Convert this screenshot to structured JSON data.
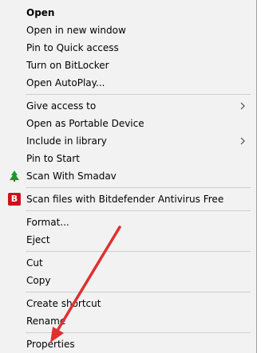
{
  "menu": {
    "items": [
      {
        "label": "Open"
      },
      {
        "label": "Open in new window"
      },
      {
        "label": "Pin to Quick access"
      },
      {
        "label": "Turn on BitLocker"
      },
      {
        "label": "Open AutoPlay..."
      },
      {
        "label": "Give access to"
      },
      {
        "label": "Open as Portable Device"
      },
      {
        "label": "Include in library"
      },
      {
        "label": "Pin to Start"
      },
      {
        "label": "Scan With Smadav"
      },
      {
        "label": "Scan files with Bitdefender Antivirus Free"
      },
      {
        "label": "Format..."
      },
      {
        "label": "Eject"
      },
      {
        "label": "Cut"
      },
      {
        "label": "Copy"
      },
      {
        "label": "Create shortcut"
      },
      {
        "label": "Rename"
      },
      {
        "label": "Properties"
      }
    ],
    "icons": {
      "smadav": "smadav-icon",
      "bitdefender": "bitdefender-icon",
      "bitdefender_letter": "B",
      "submenu": "chevron-right-icon"
    }
  },
  "colors": {
    "menu_background": "#f2f2f2",
    "separator": "#cfcfcf",
    "annotation_arrow": "#e03030",
    "bitdefender_red": "#d0101a",
    "smadav_green": "#1a9a2a"
  }
}
